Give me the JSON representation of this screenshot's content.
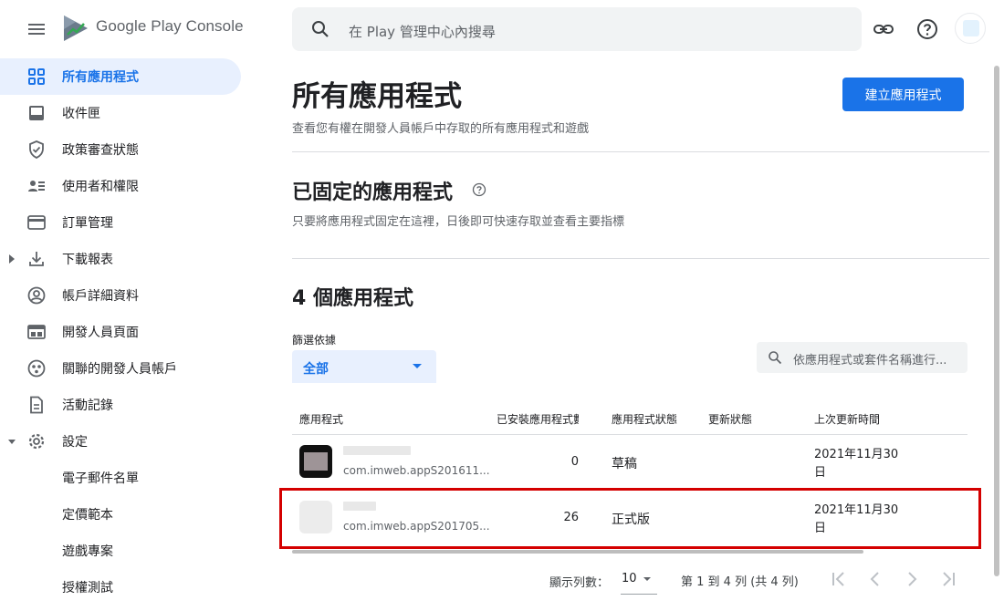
{
  "brand": {
    "google": "Google",
    "play": "Play",
    "console": "Console"
  },
  "search": {
    "placeholder": "在 Play 管理中心內搜尋"
  },
  "sidebar": {
    "items": [
      {
        "label": "所有應用程式",
        "icon": "grid-icon",
        "active": true
      },
      {
        "label": "收件匣",
        "icon": "inbox-icon"
      },
      {
        "label": "政策審查狀態",
        "icon": "shield-check-icon"
      },
      {
        "label": "使用者和權限",
        "icon": "people-list-icon"
      },
      {
        "label": "訂單管理",
        "icon": "credit-card-icon"
      },
      {
        "label": "下載報表",
        "icon": "download-icon",
        "expandable": true
      },
      {
        "label": "帳戶詳細資料",
        "icon": "account-circle-icon"
      },
      {
        "label": "開發人員頁面",
        "icon": "web-page-icon"
      },
      {
        "label": "關聯的開發人員帳戶",
        "icon": "linked-accounts-icon"
      },
      {
        "label": "活動記錄",
        "icon": "document-icon"
      },
      {
        "label": "設定",
        "icon": "gear-icon",
        "expanded": true
      },
      {
        "label": "電子郵件名單"
      },
      {
        "label": "定價範本"
      },
      {
        "label": "遊戲專案"
      },
      {
        "label": "授權測試"
      }
    ]
  },
  "main": {
    "title": "所有應用程式",
    "subtitle": "查看您有權在開發人員帳戶中存取的所有應用程式和遊戲",
    "create_button": "建立應用程式",
    "pinned": {
      "title": "已固定的應用程式",
      "subtitle": "只要將應用程式固定在這裡，日後即可快速存取並查看主要指標"
    },
    "apps_title": "4 個應用程式",
    "filter": {
      "label": "篩選依據",
      "value": "全部"
    },
    "table_search": {
      "placeholder": "依應用程式或套件名稱進行..."
    },
    "table": {
      "headers": [
        "應用程式",
        "已安裝應用程式數",
        "應用程式狀態",
        "更新狀態",
        "上次更新時間"
      ],
      "rows": [
        {
          "package": "com.imweb.appS201611...",
          "installs": "0",
          "status": "草稿",
          "update_status": "",
          "updated_line1": "2021年11月30",
          "updated_line2": "日"
        },
        {
          "package": "com.imweb.appS201705...",
          "installs": "26",
          "status": "正式版",
          "update_status": "",
          "updated_line1": "2021年11月30",
          "updated_line2": "日"
        }
      ]
    },
    "pagination": {
      "rows_label": "顯示列數：",
      "rows_value": "10",
      "range": "第 1 到 4 列 (共 4 列)"
    }
  },
  "colors": {
    "accent": "#1a73e8",
    "highlight": "#d40000",
    "active_bg": "#e8f0fe"
  }
}
